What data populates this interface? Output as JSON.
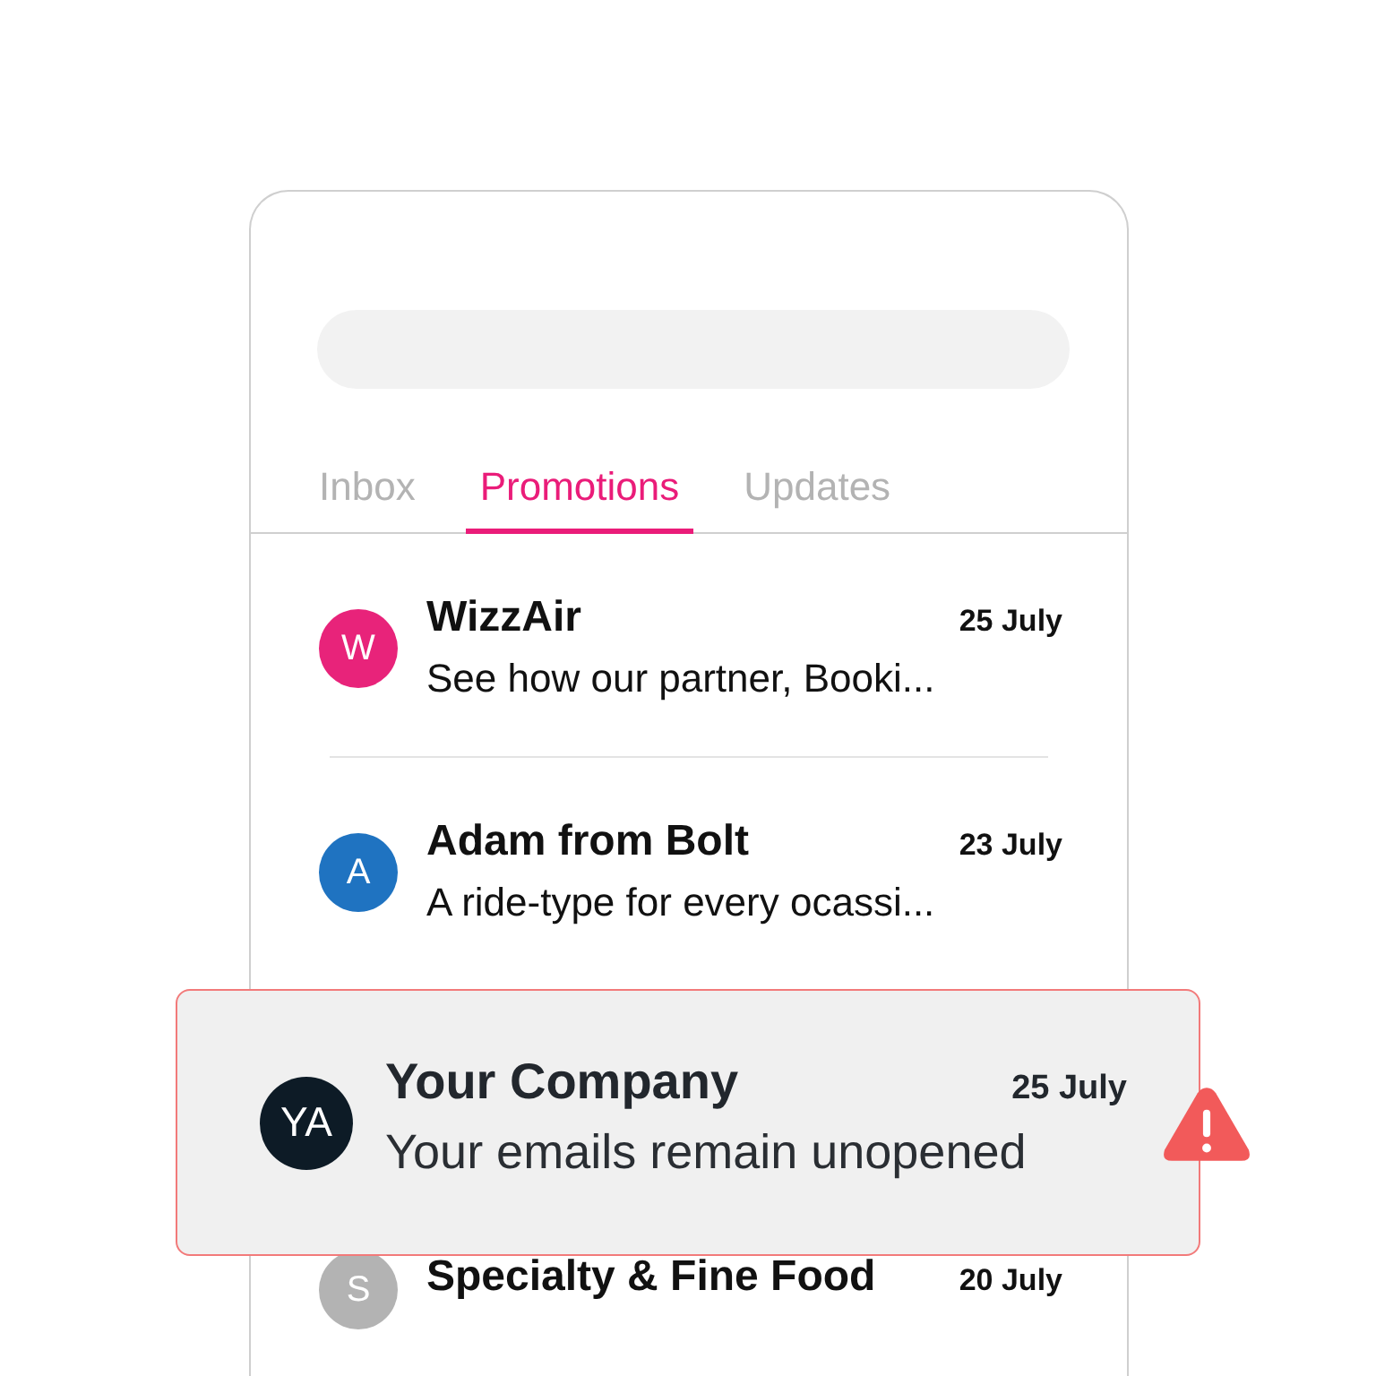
{
  "tabs": [
    {
      "label": "Inbox",
      "selected": false
    },
    {
      "label": "Promotions",
      "selected": true
    },
    {
      "label": "Updates",
      "selected": false
    }
  ],
  "messages": [
    {
      "initial": "W",
      "color": "#e8237a",
      "sender": "WizzAir",
      "date": "25 July",
      "preview": "See how our partner, Booki..."
    },
    {
      "initial": "A",
      "color": "#1f73c1",
      "sender": "Adam from Bolt",
      "date": "23 July",
      "preview": "A ride-type for every ocassi..."
    }
  ],
  "alert": {
    "initial": "YA",
    "sender": "Your Company",
    "date": "25 July",
    "message": "Your emails remain unopened"
  },
  "more_messages": [
    {
      "initial": "S",
      "color": "#b3b3b3",
      "sender": "Specialty & Fine Food",
      "date": "20 July"
    }
  ]
}
